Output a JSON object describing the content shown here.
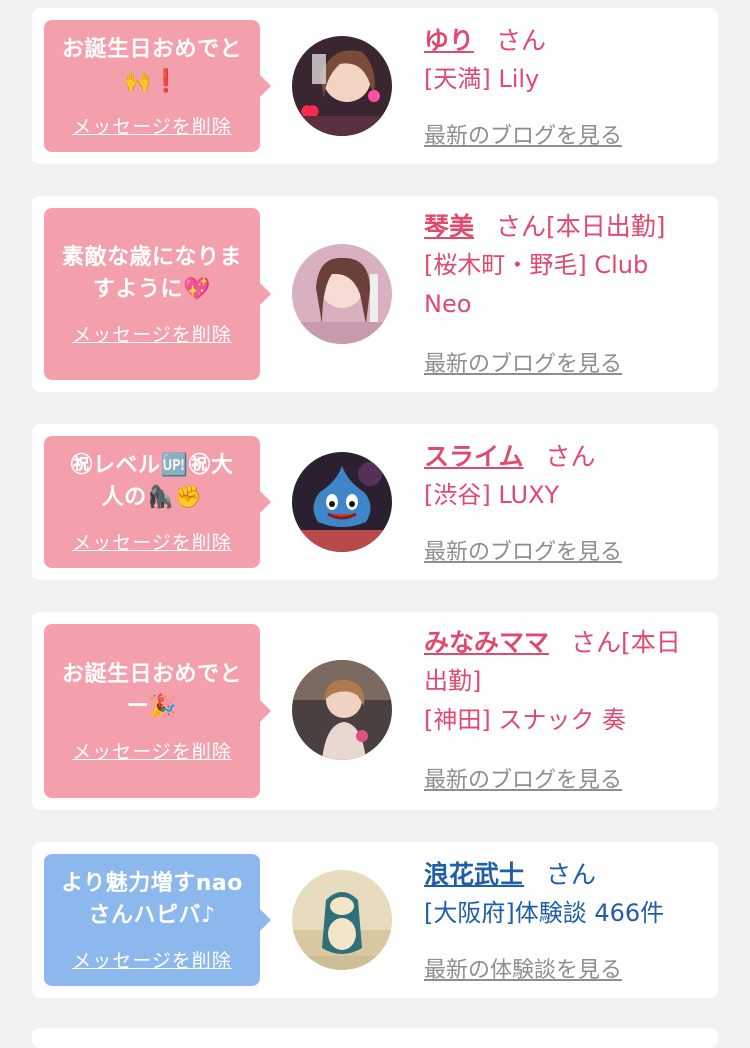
{
  "delete_label": "メッセージを削除",
  "entries": [
    {
      "message": "お誕生日おめでと\n🙌❗",
      "name": "ゆり",
      "honorific": "さん",
      "location": "[天満] Lily",
      "link": "最新のブログを見る"
    },
    {
      "message": "素敵な歳になりま\nすように💖",
      "name": "琴美",
      "honorific": "さん[本日出勤]",
      "location": "[桜木町・野毛] Club\nNeo",
      "link": "最新のブログを見る"
    },
    {
      "message": "㊗レベル🆙㊗大\n人の🦍✊",
      "name": "スライム",
      "honorific": "さん",
      "location": "[渋谷] LUXY",
      "link": "最新のブログを見る"
    },
    {
      "message": "お誕生日おめでと\nー🎉",
      "name": "みなみママ",
      "honorific": "さん[本日",
      "location": "出勤]\n[神田] スナック 奏",
      "link": "最新のブログを見る"
    },
    {
      "message": "より魅力増すnao\nさんハピバ♪",
      "name": "浪花武士",
      "honorific": "さん",
      "location": "[大阪府]体験談 466件",
      "link": "最新の体験談を見る"
    }
  ],
  "colors": {
    "pink_bubble": "#f4a0ac",
    "blue_bubble": "#8db8ee",
    "pink_text": "#e04a6c",
    "blue_text": "#1f5fa8"
  }
}
